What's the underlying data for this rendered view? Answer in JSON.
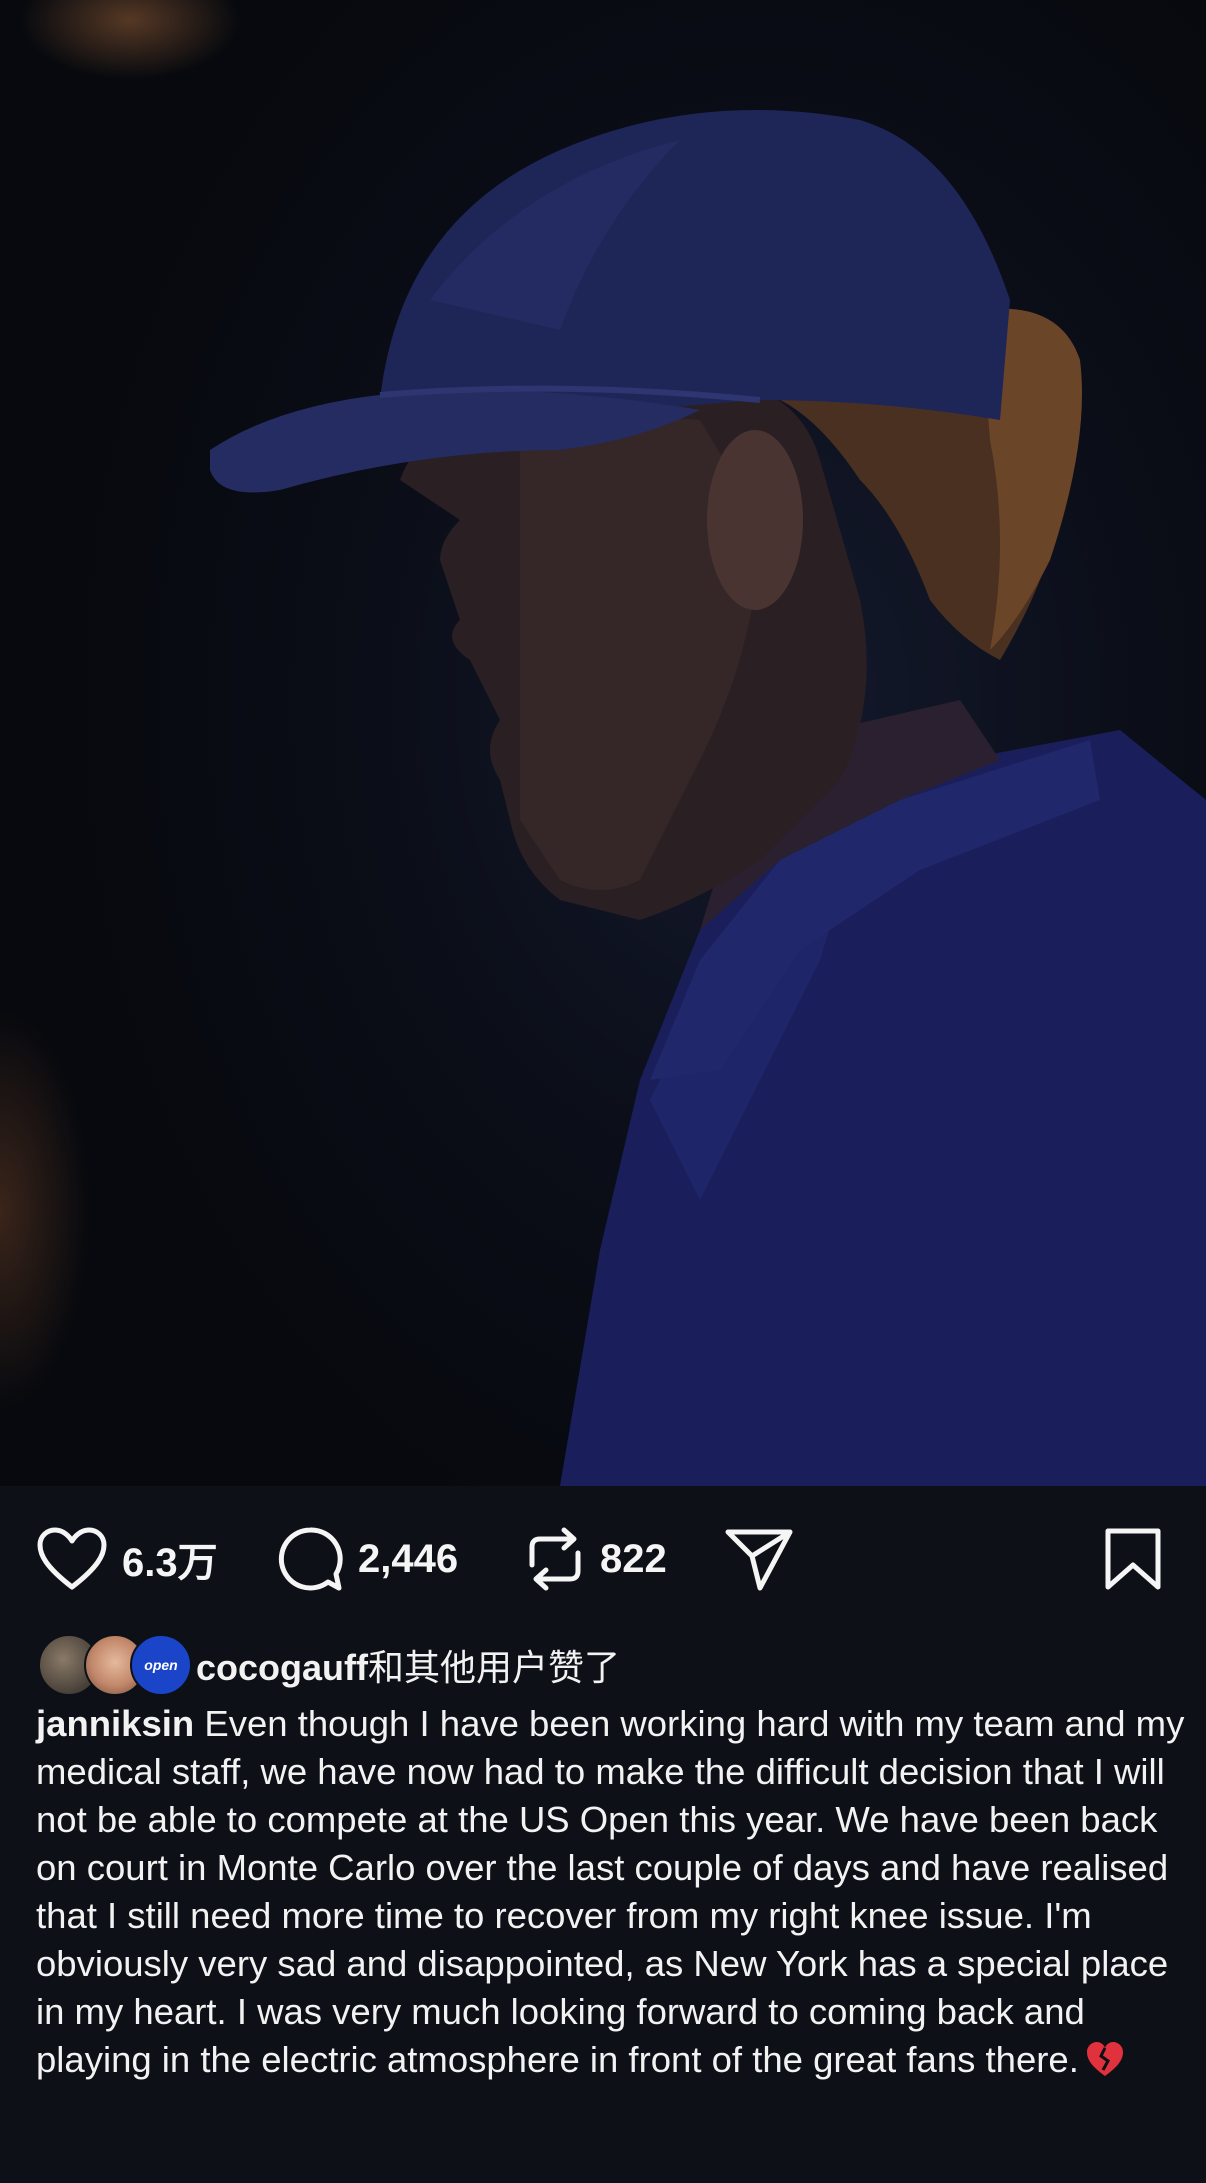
{
  "post": {
    "likes_count": "6.3万",
    "comments_count": "2,446",
    "reposts_count": "822"
  },
  "liked_by": {
    "user": "cocogauff",
    "suffix": "和其他用户赞了",
    "avatar_badge": "open"
  },
  "caption": {
    "username": "janniksin",
    "text": "Even though I have been working hard with my team and my medical staff, we have now had to make the difficult decision that I will not be able to compete at the US Open this year. We have been back on court in Monte Carlo over the last couple of days and have realised that I still need more time to recover from my right knee issue. I'm obviously very sad and disappointed, as New York has a special place in my heart. I was very much looking forward to coming back and playing in the electric atmosphere in front of the great fans there."
  },
  "icons": {
    "like": "heart-icon",
    "comment": "comment-icon",
    "repost": "repost-icon",
    "share": "send-icon",
    "save": "bookmark-icon",
    "emoji": "broken-heart-emoji"
  },
  "colors": {
    "background": "#0d1016",
    "text": "#f2f2f2",
    "shirt": "#1a1f5c",
    "cap": "#1e2557"
  }
}
